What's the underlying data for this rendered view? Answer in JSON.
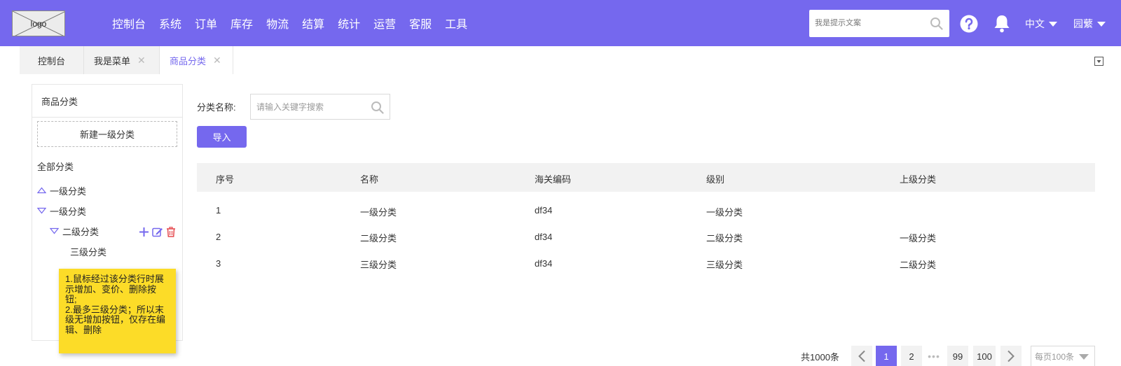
{
  "header": {
    "logo_text": "logo",
    "nav": [
      "控制台",
      "系统",
      "订单",
      "库存",
      "物流",
      "结算",
      "统计",
      "运营",
      "客服",
      "工具"
    ],
    "search_placeholder": "我是提示文案",
    "language": "中文",
    "user": "园蘩",
    "accent_color": "#7568ee"
  },
  "tabs": [
    {
      "label": "控制台",
      "closable": false,
      "active": false
    },
    {
      "label": "我是菜单",
      "closable": true,
      "active": false
    },
    {
      "label": "商品分类",
      "closable": true,
      "active": true
    }
  ],
  "sidebar": {
    "title": "商品分类",
    "new_button": "新建一级分类",
    "all_label": "全部分类",
    "tree": [
      {
        "label": "一级分类",
        "state": "collapsed"
      },
      {
        "label": "一级分类",
        "state": "expanded"
      },
      {
        "label": "二级分类",
        "state": "expanded"
      },
      {
        "label": "三级分类",
        "state": "leaf"
      }
    ],
    "row_actions": [
      "add-icon",
      "edit-icon",
      "delete-icon"
    ]
  },
  "note": {
    "lines": [
      "1.鼠标经过该分类行时展",
      "示增加、变价、删除按",
      "钮;",
      "2.最多三级分类；所以末",
      "级无增加按钮，仅存在编",
      "辑、删除"
    ]
  },
  "filter": {
    "label": "分类名称:",
    "placeholder": "请输入关键字搜索",
    "import_button": "导入"
  },
  "table": {
    "columns": [
      "序号",
      "名称",
      "海关编码",
      "级别",
      "上级分类"
    ],
    "rows": [
      [
        "1",
        "一级分类",
        "df34",
        "一级分类",
        ""
      ],
      [
        "2",
        "二级分类",
        "df34",
        "二级分类",
        "一级分类"
      ],
      [
        "3",
        "三级分类",
        "df34",
        "三级分类",
        "二级分类"
      ]
    ]
  },
  "pagination": {
    "total": "共1000条",
    "pages": [
      "1",
      "2",
      "99",
      "100"
    ],
    "current": "1",
    "ellipsis": "•••",
    "per_page": "每页100条"
  }
}
